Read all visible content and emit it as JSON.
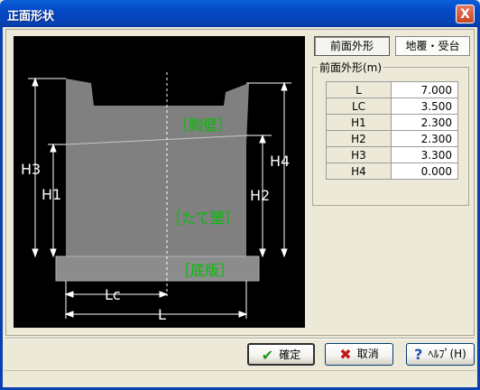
{
  "window": {
    "title": "正面形状",
    "close_label": "X"
  },
  "tabs": [
    {
      "label": "前面外形",
      "active": true
    },
    {
      "label": "地覆・受台",
      "active": false
    }
  ],
  "params": {
    "group_label": "前面外形(m)",
    "rows": [
      {
        "label": "L",
        "value": "7.000"
      },
      {
        "label": "LC",
        "value": "3.500"
      },
      {
        "label": "H1",
        "value": "2.300"
      },
      {
        "label": "H2",
        "value": "2.300"
      },
      {
        "label": "H3",
        "value": "3.300"
      },
      {
        "label": "H4",
        "value": "0.000"
      }
    ]
  },
  "diagram": {
    "labels": {
      "kyoheki": "［胸壁］",
      "tateheki": "［たて壁］",
      "teiban": "［底版］",
      "h3": "H3",
      "h1": "H1",
      "h4": "H4",
      "h2": "H2",
      "lc": "Lc",
      "l": "L"
    },
    "colors": {
      "background": "#000000",
      "body": "#808080",
      "label": "#00c000",
      "dim": "#ffffff"
    }
  },
  "buttons": {
    "ok": {
      "label": "確定",
      "icon": "checkmark-icon"
    },
    "cancel": {
      "label": "取消",
      "icon": "x-icon"
    },
    "help": {
      "label": "ﾍﾙﾌﾟ(H)",
      "icon": "question-icon"
    }
  }
}
